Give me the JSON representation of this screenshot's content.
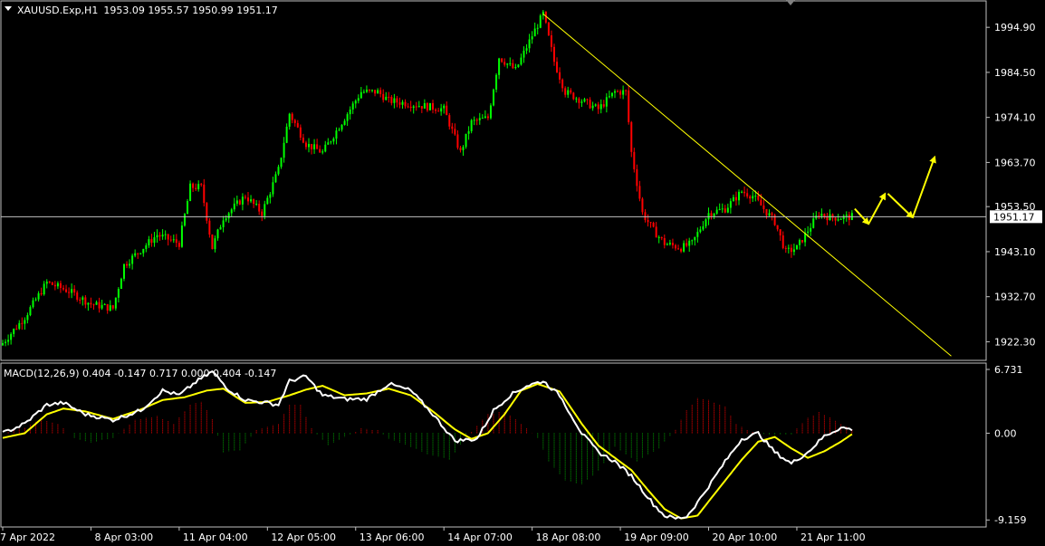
{
  "chart_data": [
    {
      "type": "candlestick",
      "title": "XAUUSD.Exp,H1",
      "ohlc_header": "1953.09 1955.57 1950.99 1951.17",
      "current_price": 1951.17,
      "current_price_label": "1951.17",
      "ylim": [
        1918,
        2001
      ],
      "y_ticks": [
        {
          "v": 1994.9,
          "label": "1994.90"
        },
        {
          "v": 1984.5,
          "label": "1984.50"
        },
        {
          "v": 1974.1,
          "label": "1974.10"
        },
        {
          "v": 1963.7,
          "label": "1963.70"
        },
        {
          "v": 1953.5,
          "label": "1953.50"
        },
        {
          "v": 1943.1,
          "label": "1943.10"
        },
        {
          "v": 1932.7,
          "label": "1932.70"
        },
        {
          "v": 1922.3,
          "label": "1922.30"
        }
      ],
      "x_labels": [
        {
          "i": 0,
          "label": "7 Apr 2022"
        },
        {
          "i": 32,
          "label": "8 Apr 03:00"
        },
        {
          "i": 64,
          "label": "11 Apr 04:00"
        },
        {
          "i": 96,
          "label": "12 Apr 05:00"
        },
        {
          "i": 128,
          "label": "13 Apr 06:00"
        },
        {
          "i": 160,
          "label": "14 Apr 07:00"
        },
        {
          "i": 192,
          "label": "18 Apr 08:00"
        },
        {
          "i": 224,
          "label": "19 Apr 09:00"
        },
        {
          "i": 256,
          "label": "20 Apr 10:00"
        },
        {
          "i": 288,
          "label": "21 Apr 11:00"
        }
      ],
      "close_anchors": [
        [
          0,
          1922
        ],
        [
          8,
          1928
        ],
        [
          16,
          1936
        ],
        [
          24,
          1934
        ],
        [
          32,
          1931
        ],
        [
          40,
          1930
        ],
        [
          44,
          1940
        ],
        [
          56,
          1947
        ],
        [
          64,
          1945
        ],
        [
          68,
          1958
        ],
        [
          72,
          1958
        ],
        [
          76,
          1944
        ],
        [
          80,
          1951
        ],
        [
          88,
          1956
        ],
        [
          94,
          1952
        ],
        [
          100,
          1962
        ],
        [
          104,
          1975
        ],
        [
          110,
          1968
        ],
        [
          116,
          1966
        ],
        [
          124,
          1974
        ],
        [
          130,
          1980
        ],
        [
          136,
          1980
        ],
        [
          140,
          1978
        ],
        [
          150,
          1977
        ],
        [
          160,
          1976
        ],
        [
          166,
          1966
        ],
        [
          170,
          1973
        ],
        [
          176,
          1974
        ],
        [
          180,
          1988
        ],
        [
          186,
          1985
        ],
        [
          192,
          1993
        ],
        [
          196,
          1998
        ],
        [
          200,
          1987
        ],
        [
          204,
          1980
        ],
        [
          210,
          1978
        ],
        [
          216,
          1976
        ],
        [
          222,
          1980
        ],
        [
          226,
          1980
        ],
        [
          228,
          1966
        ],
        [
          232,
          1952
        ],
        [
          236,
          1948
        ],
        [
          240,
          1945
        ],
        [
          246,
          1944
        ],
        [
          250,
          1945
        ],
        [
          256,
          1952
        ],
        [
          262,
          1953
        ],
        [
          268,
          1957
        ],
        [
          272,
          1956
        ],
        [
          276,
          1953
        ],
        [
          280,
          1950
        ],
        [
          284,
          1943
        ],
        [
          288,
          1944
        ],
        [
          292,
          1948
        ],
        [
          296,
          1952
        ],
        [
          300,
          1951
        ],
        [
          304,
          1951
        ],
        [
          308,
          1951.17
        ]
      ],
      "trendline": {
        "from": [
          196,
          1998
        ],
        "to": [
          344,
          1919
        ]
      },
      "arrows": [
        {
          "from": [
            309,
            1953
          ],
          "to": [
            314,
            1949.5
          ]
        },
        {
          "from": [
            314,
            1949.5
          ],
          "to": [
            320,
            1956.5
          ]
        },
        {
          "from": [
            321,
            1956.5
          ],
          "to": [
            330,
            1951
          ]
        },
        {
          "from": [
            330,
            1951
          ],
          "to": [
            338,
            1965
          ]
        }
      ],
      "colors": {
        "up": "#00ff00",
        "down": "#ff0000",
        "trendline": "#ffff00",
        "arrows": "#ffff00",
        "grid": "#c0c0c0"
      }
    },
    {
      "type": "macd",
      "title": "MACD(12,26,9) 0.404 -0.147 0.717 0.000 0.404 -0.147",
      "ylim": [
        -9.9,
        7.4
      ],
      "y_ticks": [
        {
          "v": 6.731,
          "label": "6.731"
        },
        {
          "v": 0.0,
          "label": "0.00"
        },
        {
          "v": -9.159,
          "label": "-9.159"
        }
      ],
      "macd_anchors": [
        [
          0,
          0
        ],
        [
          8,
          1
        ],
        [
          16,
          3
        ],
        [
          22,
          3.2
        ],
        [
          30,
          2
        ],
        [
          40,
          1.4
        ],
        [
          50,
          2.4
        ],
        [
          58,
          4.5
        ],
        [
          64,
          4
        ],
        [
          70,
          5.4
        ],
        [
          76,
          6.5
        ],
        [
          82,
          4.6
        ],
        [
          88,
          3.5
        ],
        [
          96,
          3.2
        ],
        [
          100,
          3
        ],
        [
          104,
          5.5
        ],
        [
          110,
          6
        ],
        [
          116,
          4
        ],
        [
          124,
          3.6
        ],
        [
          132,
          3.6
        ],
        [
          140,
          5.2
        ],
        [
          148,
          4.5
        ],
        [
          156,
          2
        ],
        [
          164,
          -0.8
        ],
        [
          172,
          -0.6
        ],
        [
          178,
          2.4
        ],
        [
          184,
          4
        ],
        [
          190,
          5
        ],
        [
          196,
          5.5
        ],
        [
          202,
          4
        ],
        [
          210,
          0
        ],
        [
          216,
          -2
        ],
        [
          222,
          -3
        ],
        [
          228,
          -4.5
        ],
        [
          232,
          -6
        ],
        [
          236,
          -7.5
        ],
        [
          240,
          -8.7
        ],
        [
          244,
          -9
        ],
        [
          248,
          -8.8
        ],
        [
          252,
          -7.3
        ],
        [
          256,
          -5.6
        ],
        [
          262,
          -3
        ],
        [
          268,
          -0.6
        ],
        [
          274,
          0
        ],
        [
          280,
          -2
        ],
        [
          286,
          -3.2
        ],
        [
          292,
          -2
        ],
        [
          298,
          -0.3
        ],
        [
          304,
          0.6
        ],
        [
          308,
          0.4
        ]
      ],
      "signal_anchors": [
        [
          0,
          -0.5
        ],
        [
          8,
          0
        ],
        [
          16,
          2
        ],
        [
          22,
          2.6
        ],
        [
          30,
          2.3
        ],
        [
          40,
          1.5
        ],
        [
          50,
          2.5
        ],
        [
          58,
          3.5
        ],
        [
          66,
          3.8
        ],
        [
          74,
          4.5
        ],
        [
          80,
          4.7
        ],
        [
          88,
          3.2
        ],
        [
          96,
          3.3
        ],
        [
          104,
          4
        ],
        [
          110,
          4.6
        ],
        [
          116,
          5
        ],
        [
          124,
          4
        ],
        [
          132,
          4.2
        ],
        [
          140,
          4.7
        ],
        [
          148,
          4
        ],
        [
          156,
          2.3
        ],
        [
          164,
          0.4
        ],
        [
          170,
          -0.6
        ],
        [
          176,
          0
        ],
        [
          182,
          2
        ],
        [
          188,
          4.5
        ],
        [
          194,
          5.2
        ],
        [
          202,
          4.4
        ],
        [
          210,
          1
        ],
        [
          216,
          -1.3
        ],
        [
          222,
          -2.6
        ],
        [
          228,
          -3.9
        ],
        [
          234,
          -6
        ],
        [
          240,
          -8
        ],
        [
          246,
          -9
        ],
        [
          252,
          -8.7
        ],
        [
          256,
          -7.2
        ],
        [
          262,
          -5
        ],
        [
          268,
          -2.8
        ],
        [
          274,
          -0.9
        ],
        [
          280,
          -0.4
        ],
        [
          286,
          -1.6
        ],
        [
          292,
          -2.6
        ],
        [
          298,
          -1.9
        ],
        [
          304,
          -0.9
        ],
        [
          308,
          -0.1
        ]
      ],
      "histogram_anchors": [
        [
          0,
          0
        ],
        [
          8,
          0.6
        ],
        [
          14,
          1.5
        ],
        [
          20,
          1
        ],
        [
          26,
          -0.5
        ],
        [
          32,
          -1
        ],
        [
          40,
          -0.5
        ],
        [
          48,
          1.4
        ],
        [
          56,
          1.8
        ],
        [
          62,
          1
        ],
        [
          68,
          3
        ],
        [
          72,
          3.3
        ],
        [
          76,
          1.5
        ],
        [
          80,
          -2
        ],
        [
          86,
          -1.8
        ],
        [
          92,
          0.3
        ],
        [
          100,
          1
        ],
        [
          104,
          3
        ],
        [
          108,
          3
        ],
        [
          112,
          0.5
        ],
        [
          118,
          -1.3
        ],
        [
          124,
          -0.4
        ],
        [
          130,
          0.5
        ],
        [
          136,
          0.3
        ],
        [
          140,
          -0.6
        ],
        [
          146,
          -1.2
        ],
        [
          154,
          -2.2
        ],
        [
          162,
          -2.8
        ],
        [
          168,
          -0.4
        ],
        [
          176,
          2
        ],
        [
          182,
          2.3
        ],
        [
          188,
          1
        ],
        [
          194,
          -0.5
        ],
        [
          198,
          -3
        ],
        [
          204,
          -5
        ],
        [
          210,
          -5.4
        ],
        [
          216,
          -4
        ],
        [
          222,
          -1.4
        ],
        [
          230,
          -3
        ],
        [
          238,
          -1.6
        ],
        [
          244,
          0.4
        ],
        [
          248,
          2.4
        ],
        [
          252,
          3.7
        ],
        [
          256,
          3.5
        ],
        [
          262,
          2.8
        ],
        [
          266,
          1
        ],
        [
          270,
          0.3
        ],
        [
          278,
          -0.2
        ],
        [
          286,
          -0.1
        ],
        [
          292,
          1.6
        ],
        [
          296,
          2.2
        ],
        [
          300,
          1.7
        ],
        [
          304,
          1
        ],
        [
          308,
          0.4
        ]
      ],
      "colors": {
        "macd": "#ffffff",
        "signal": "#ffff00",
        "hist_up": "#ff0000",
        "hist_down": "#00a000"
      }
    }
  ]
}
